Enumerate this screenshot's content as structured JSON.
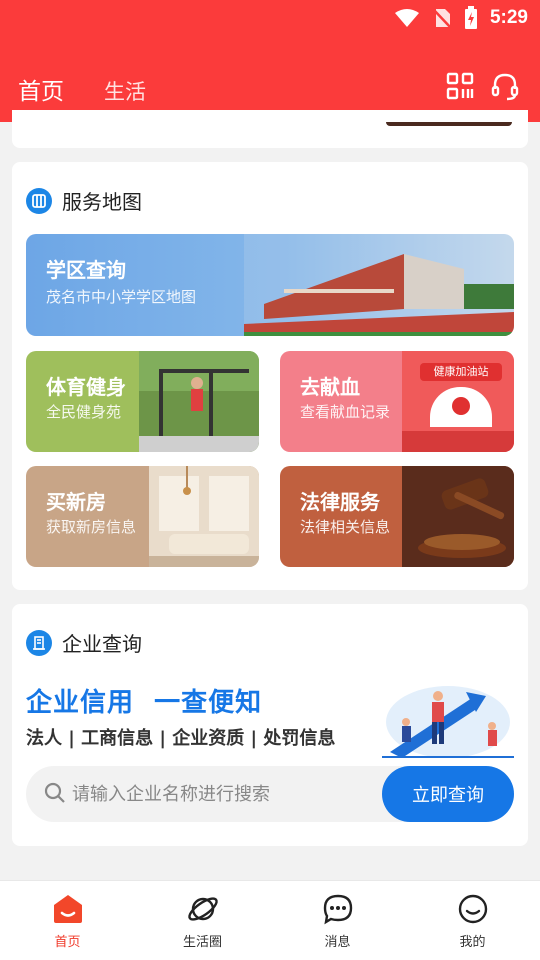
{
  "status_bar": {
    "time": "5:29"
  },
  "header": {
    "tabs": [
      {
        "label": "首页",
        "active": true
      },
      {
        "label": "生活",
        "active": false
      }
    ],
    "accent": "#fb3b3b"
  },
  "service_map": {
    "title": "服务地图",
    "tiles": [
      {
        "title": "学区查询",
        "subtitle": "茂名市中小学学区地图"
      },
      {
        "title": "体育健身",
        "subtitle": "全民健身苑"
      },
      {
        "title": "去献血",
        "subtitle": "查看献血记录",
        "banner_text": "健康加油站"
      },
      {
        "title": "买新房",
        "subtitle": "获取新房信息"
      },
      {
        "title": "法律服务",
        "subtitle": "法律相关信息"
      }
    ]
  },
  "enterprise": {
    "title": "企业查询",
    "slogan": "企业信用  一查便知",
    "tags": "法人 | 工商信息 | 企业资质 | 处罚信息",
    "search_placeholder": "请输入企业名称进行搜索",
    "search_button": "立即查询",
    "brand": "#1677e6"
  },
  "bottom_nav": [
    {
      "label": "首页",
      "icon": "home-icon",
      "active": true
    },
    {
      "label": "生活圈",
      "icon": "planet-icon",
      "active": false
    },
    {
      "label": "消息",
      "icon": "chat-bubble-icon",
      "active": false
    },
    {
      "label": "我的",
      "icon": "smile-face-icon",
      "active": false
    }
  ]
}
